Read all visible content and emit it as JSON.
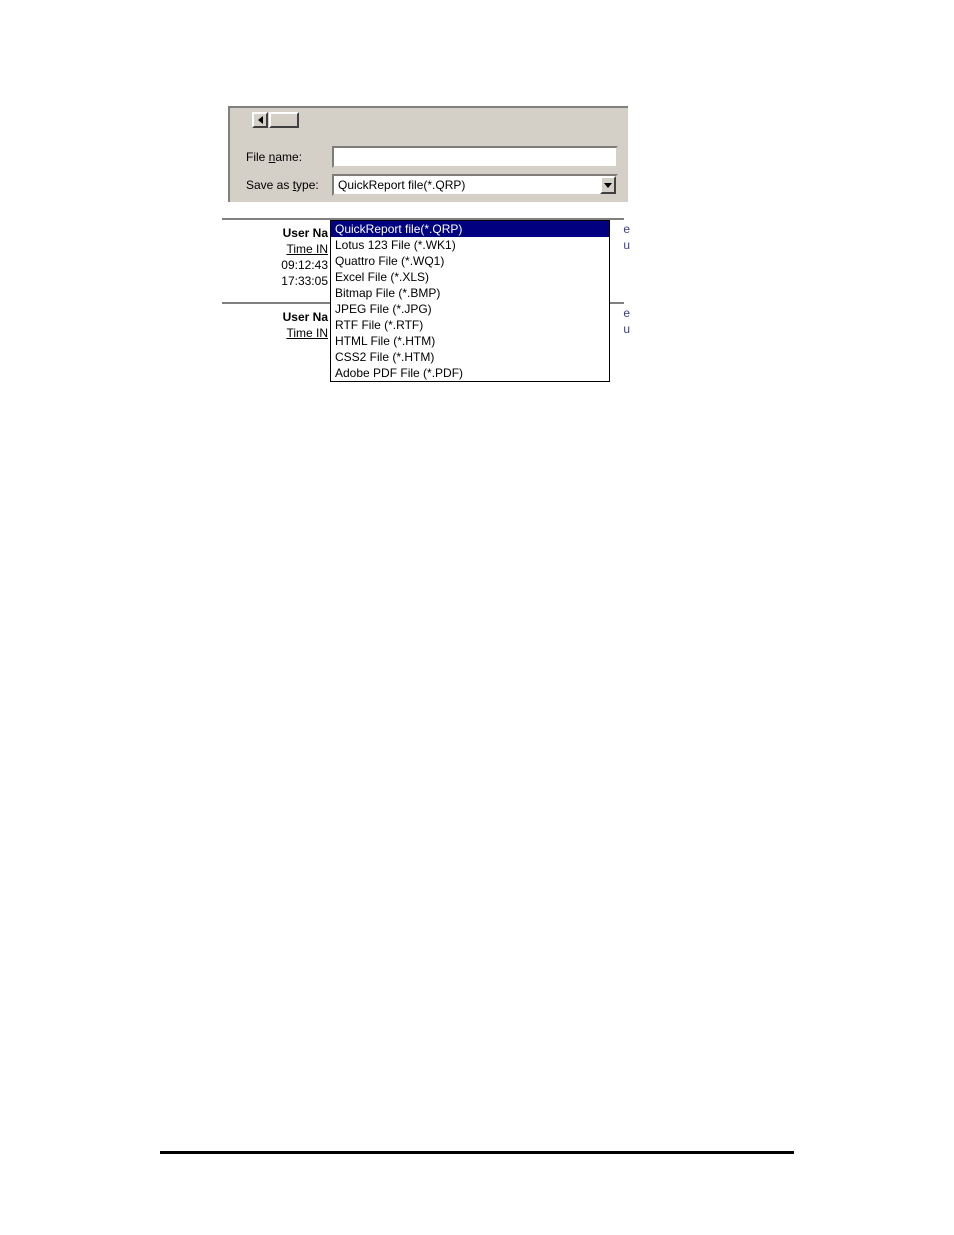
{
  "dialog": {
    "file_name_label_prefix": "File ",
    "file_name_label_u": "n",
    "file_name_label_suffix": "ame:",
    "file_name_value": "",
    "save_as_type_label_prefix": "Save as ",
    "save_as_type_label_u": "t",
    "save_as_type_label_suffix": "ype:",
    "combo_selected": "QuickReport file(*.QRP)",
    "options": [
      "QuickReport file(*.QRP)",
      "Lotus 123 File (*.WK1)",
      "Quattro File (*.WQ1)",
      "Excel File (*.XLS)",
      "Bitmap File (*.BMP)",
      "JPEG File (*.JPG)",
      "RTF File (*.RTF)",
      "HTML File (*.HTM)",
      "CSS2 File (*.HTM)",
      "Adobe PDF File (*.PDF)"
    ]
  },
  "report": {
    "user_na_label": "User Na",
    "time_in_label": "Time IN",
    "rows": [
      "09:12:43",
      "17:33:05"
    ],
    "edge_letters": {
      "a": "e",
      "b": "u"
    }
  }
}
